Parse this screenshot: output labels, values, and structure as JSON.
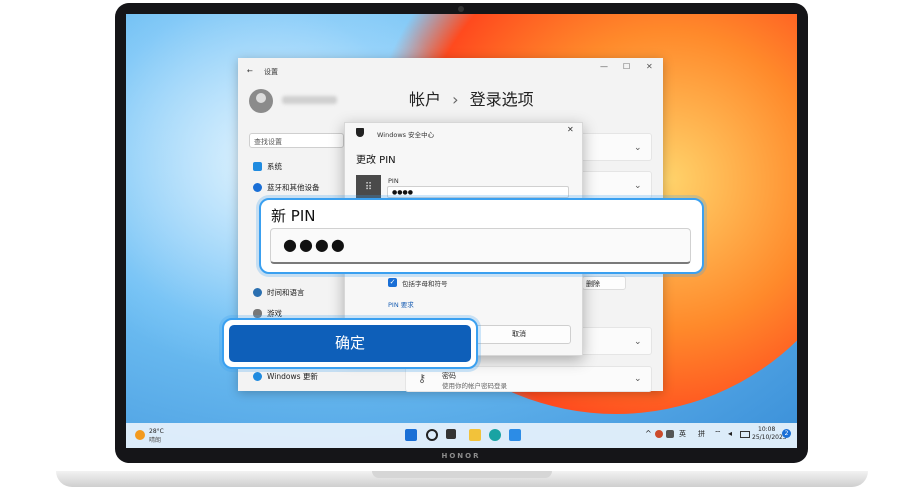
{
  "laptop": {
    "brand": "HONOR"
  },
  "settings": {
    "back": "←",
    "title": "设置",
    "search_placeholder": "查找设置",
    "nav": [
      {
        "label": "系统",
        "icon": "monitor-icon",
        "color": "#1f8be0"
      },
      {
        "label": "蓝牙和其他设备",
        "icon": "bluetooth-icon",
        "color": "#1a6fd6"
      },
      {
        "label": "时间和语言",
        "icon": "clock-globe-icon",
        "color": "#2a6fb0"
      },
      {
        "label": "游戏",
        "icon": "gamepad-icon",
        "color": "#777777"
      },
      {
        "label": "Windows 更新",
        "icon": "update-icon",
        "color": "#1f8be0"
      }
    ],
    "heading_left": "帐户",
    "heading_sep": "›",
    "heading_right": "登录选项",
    "window_controls": {
      "minimize": "—",
      "maximize": "☐",
      "close": "✕"
    },
    "password_title": "密码",
    "password_desc": "使用你的帐户密码登录",
    "delete_label": "删除"
  },
  "dialog": {
    "app_name": "Windows 安全中心",
    "close": "✕",
    "title": "更改 PIN",
    "pin_label": "PIN",
    "pin_value": "●●●●",
    "include_label": "包括字母和符号",
    "requirements_link": "PIN 要求",
    "cancel_label": "取消"
  },
  "callout_pin": {
    "label": "新 PIN",
    "value": "●●●●"
  },
  "callout_ok": {
    "label": "确定"
  },
  "taskbar": {
    "weather_temp": "28°C",
    "weather_desc": "晴朗",
    "tray_chevron": "^",
    "lang": "英",
    "ime": "拼",
    "time": "10:08",
    "date": "25/10/2023",
    "badge": "2"
  }
}
